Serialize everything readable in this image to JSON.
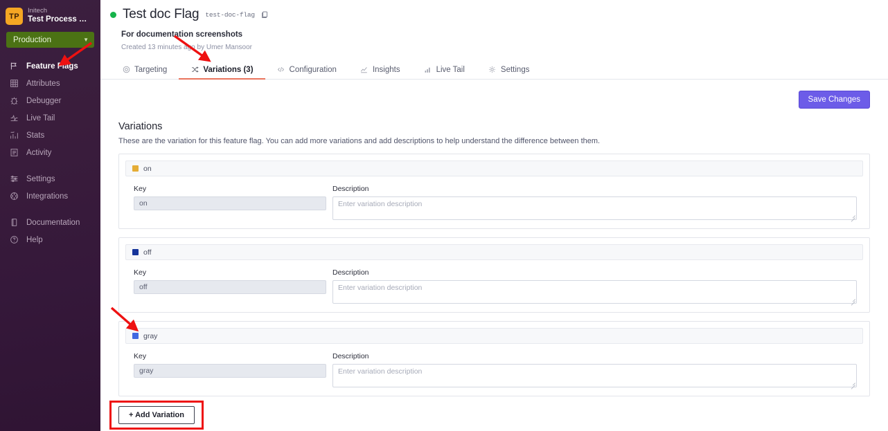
{
  "sidebar": {
    "org": {
      "logo_initials": "TP",
      "org_name": "Initech",
      "project_name": "Test Process …"
    },
    "environment": {
      "label": "Production",
      "caret": "chevron-down-icon"
    },
    "items": [
      {
        "label": "Feature Flags",
        "icon": "flag-icon",
        "active": true
      },
      {
        "label": "Attributes",
        "icon": "grid-icon",
        "active": false
      },
      {
        "label": "Debugger",
        "icon": "bug-icon",
        "active": false
      },
      {
        "label": "Live Tail",
        "icon": "pulse-icon",
        "active": false
      },
      {
        "label": "Stats",
        "icon": "bar-chart-icon",
        "active": false
      },
      {
        "label": "Activity",
        "icon": "list-icon",
        "active": false
      }
    ],
    "items2": [
      {
        "label": "Settings",
        "icon": "sliders-icon",
        "active": false
      },
      {
        "label": "Integrations",
        "icon": "puzzle-icon",
        "active": false
      }
    ],
    "items3": [
      {
        "label": "Documentation",
        "icon": "book-icon",
        "active": false
      },
      {
        "label": "Help",
        "icon": "question-circle-icon",
        "active": false
      }
    ]
  },
  "header": {
    "status": "enabled",
    "title": "Test doc Flag",
    "flag_key": "test-doc-flag",
    "copy_icon": "copy-icon",
    "description": "For documentation screenshots",
    "meta": "Created 13 minutes ago by Umer Mansoor"
  },
  "tabs": [
    {
      "label": "Targeting",
      "icon": "target-icon",
      "active": false
    },
    {
      "label": "Variations (3)",
      "icon": "shuffle-icon",
      "active": true
    },
    {
      "label": "Configuration",
      "icon": "code-icon",
      "active": false
    },
    {
      "label": "Insights",
      "icon": "line-chart-icon",
      "active": false
    },
    {
      "label": "Live Tail",
      "icon": "signal-icon",
      "active": false
    },
    {
      "label": "Settings",
      "icon": "gear-icon",
      "active": false
    }
  ],
  "toolbar": {
    "save_label": "Save Changes"
  },
  "section": {
    "title": "Variations",
    "subtitle": "These are the variation for this feature flag. You can add more variations and add descriptions to help understand the difference between them."
  },
  "labels": {
    "key": "Key",
    "description": "Description",
    "desc_placeholder": "Enter variation description"
  },
  "variations": [
    {
      "name": "on",
      "swatch_color": "#e5ad36",
      "key_value": "on",
      "description_value": ""
    },
    {
      "name": "off",
      "swatch_color": "#17359b",
      "key_value": "off",
      "description_value": ""
    },
    {
      "name": "gray",
      "swatch_color": "#4169e1",
      "key_value": "gray",
      "description_value": ""
    }
  ],
  "add_variation": {
    "label": "+ Add Variation"
  },
  "colors": {
    "accent_purple": "#6c5ce8",
    "tab_underline": "#e9735c",
    "env_green": "#4b7214",
    "status_dot": "#16b34a",
    "annotation_red": "#ee1111",
    "sidebar_bg": "#3a1d3c"
  }
}
